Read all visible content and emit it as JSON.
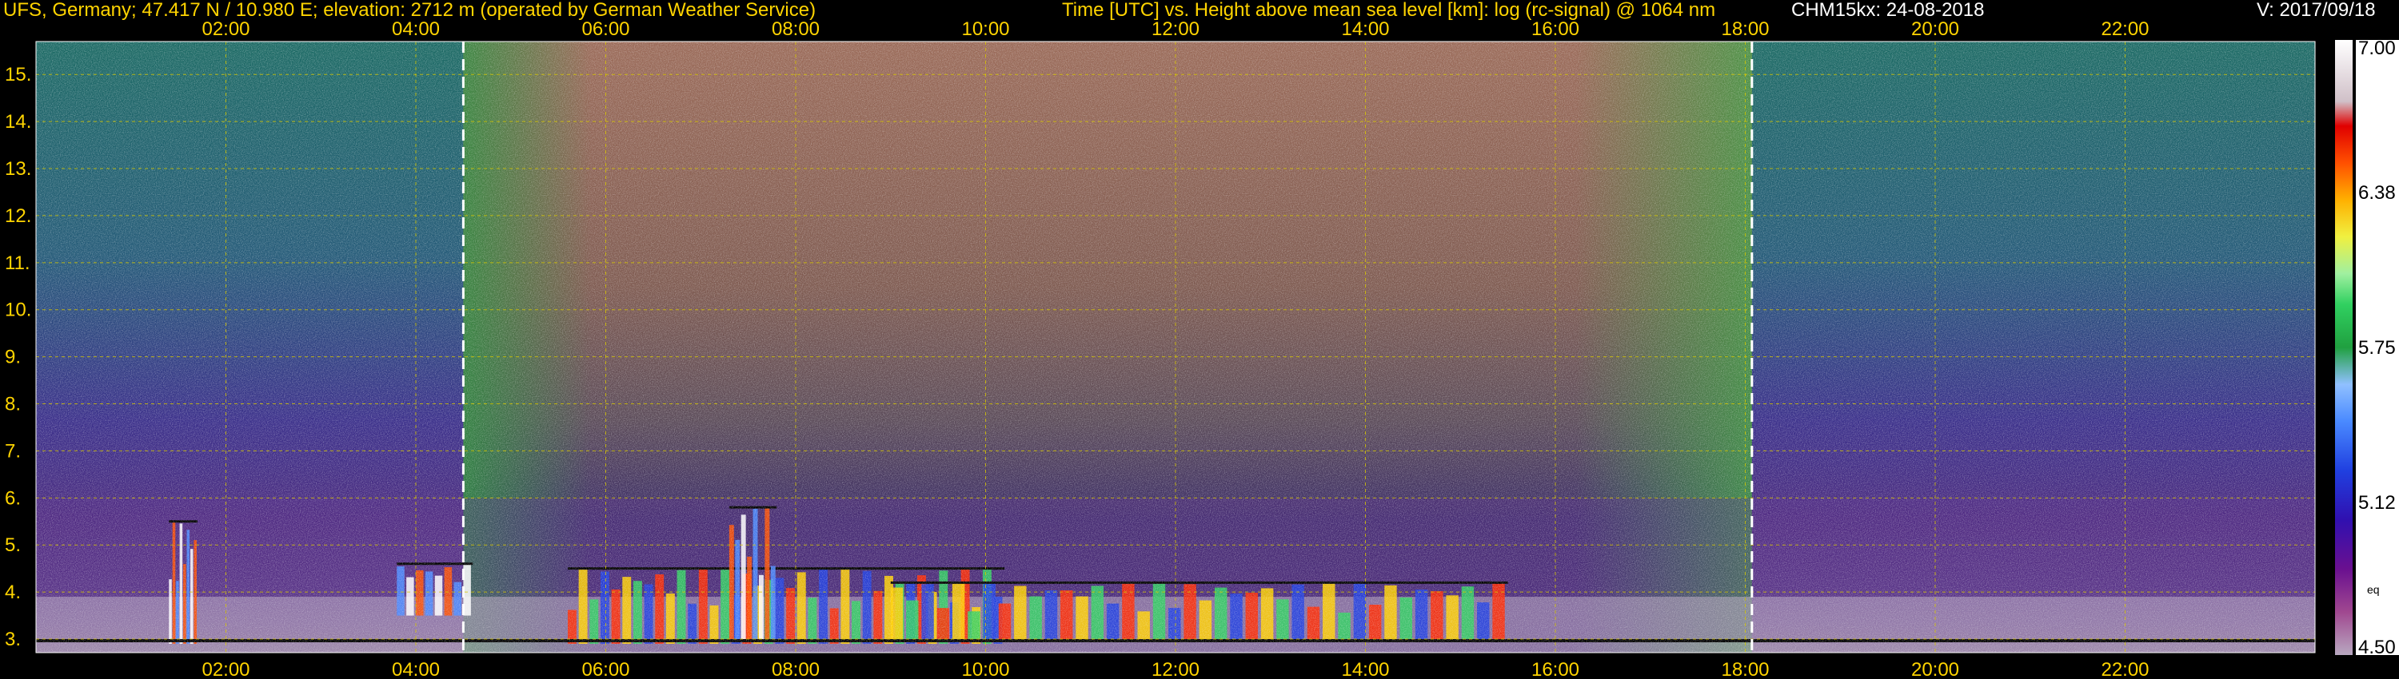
{
  "header": {
    "left": "UFS, Germany; 47.417 N / 10.980 E; elevation: 2712 m  (operated by German Weather Service)",
    "middle": "Time [UTC] vs. Height above mean sea level [km]: log (rc-signal) @ 1064 nm",
    "instrument": "CHM15kx: 24-08-2018",
    "version": "V: 2017/09/18"
  },
  "colors": {
    "text": "#ffd400",
    "grid": "#d8c800",
    "night_marker": "#ffffff"
  },
  "chart_data": {
    "type": "heatmap",
    "title": "Time [UTC] vs. Height above mean sea level [km]: log (rc-signal) @ 1064 nm",
    "x_unit": "Time [UTC]",
    "y_unit": "Height above mean sea level [km]",
    "xlim": [
      0.0,
      24.0
    ],
    "ylim": [
      2.712,
      15.7
    ],
    "x_ticks": [
      "02:00",
      "04:00",
      "06:00",
      "08:00",
      "10:00",
      "12:00",
      "14:00",
      "16:00",
      "18:00",
      "20:00",
      "22:00"
    ],
    "x_tick_values": [
      2,
      4,
      6,
      8,
      10,
      12,
      14,
      16,
      18,
      20,
      22
    ],
    "y_ticks": [
      "3.",
      "4.",
      "5.",
      "6.",
      "7.",
      "8.",
      "9.",
      "10.",
      "11.",
      "12.",
      "13.",
      "14.",
      "15."
    ],
    "y_tick_values": [
      3,
      4,
      5,
      6,
      7,
      8,
      9,
      10,
      11,
      12,
      13,
      14,
      15
    ],
    "grid": true,
    "vertical_markers_utc": [
      4.5,
      18.07
    ],
    "colorbar": {
      "range": [
        4.5,
        7.0
      ],
      "ticks": [
        "7.00",
        "6.38",
        "5.75",
        "5.12",
        "4.50"
      ],
      "tick_values": [
        7.0,
        6.38,
        5.75,
        5.12,
        4.5
      ],
      "unit": "eq"
    },
    "features": [
      {
        "kind": "aerosol_layer",
        "t_start": 5.6,
        "t_end": 10.2,
        "h_bottom": 2.9,
        "h_top": 4.5
      },
      {
        "kind": "aerosol_layer",
        "t_start": 9.0,
        "t_end": 15.5,
        "h_bottom": 3.0,
        "h_top": 4.2
      },
      {
        "kind": "cloud_layer",
        "t_start": 3.8,
        "t_end": 4.6,
        "h_bottom": 3.5,
        "h_top": 4.6
      },
      {
        "kind": "cloud_layer",
        "t_start": 1.4,
        "t_end": 1.7,
        "h_bottom": 2.9,
        "h_top": 5.5
      },
      {
        "kind": "cloud_layer",
        "t_start": 7.3,
        "t_end": 7.8,
        "h_bottom": 3.0,
        "h_top": 5.8
      }
    ]
  }
}
